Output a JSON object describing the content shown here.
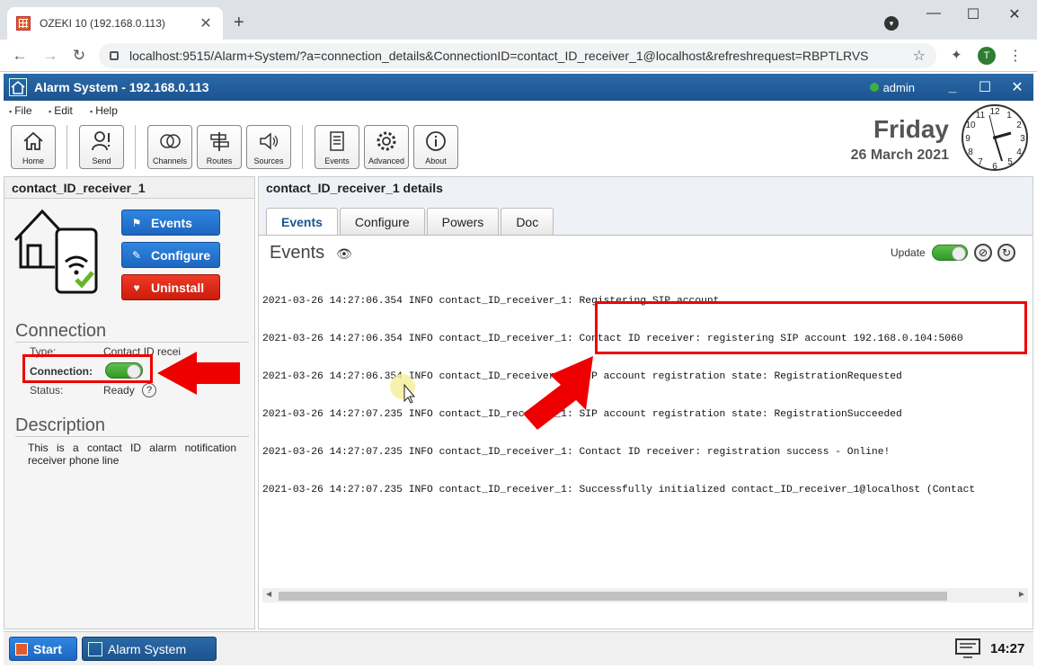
{
  "browser": {
    "tab_title": "OZEKI 10 (192.168.0.113)",
    "url": "localhost:9515/Alarm+System/?a=connection_details&ConnectionID=contact_ID_receiver_1@localhost&refreshrequest=RBPTLRVS",
    "avatar_letter": "T"
  },
  "app": {
    "title": "Alarm System - 192.168.0.113",
    "user": "admin",
    "menu": [
      "File",
      "Edit",
      "Help"
    ],
    "toolbar": [
      {
        "label": "Home",
        "icon": "home-icon"
      },
      {
        "label": "Send",
        "icon": "person-icon"
      },
      {
        "label": "Channels",
        "icon": "channels-icon"
      },
      {
        "label": "Routes",
        "icon": "routes-icon"
      },
      {
        "label": "Sources",
        "icon": "speaker-icon"
      },
      {
        "label": "Events",
        "icon": "list-icon"
      },
      {
        "label": "Advanced",
        "icon": "gear-icon"
      },
      {
        "label": "About",
        "icon": "info-icon"
      }
    ],
    "day": "Friday",
    "date": "26 March 2021"
  },
  "left": {
    "title": "contact_ID_receiver_1",
    "buttons": {
      "events": "Events",
      "configure": "Configure",
      "uninstall": "Uninstall"
    },
    "connection_heading": "Connection",
    "type_label": "Type:",
    "type_value": "Contact ID recei",
    "connection_label": "Connection:",
    "status_label": "Status:",
    "status_value": "Ready",
    "description_heading": "Description",
    "description": "This is a contact ID alarm notification receiver phone line"
  },
  "right": {
    "title": "contact_ID_receiver_1 details",
    "tabs": [
      "Events",
      "Configure",
      "Powers",
      "Doc"
    ],
    "events_heading": "Events",
    "update_label": "Update",
    "log": [
      "2021-03-26 14:27:06.354 INFO contact_ID_receiver_1: Registering SIP account",
      "2021-03-26 14:27:06.354 INFO contact_ID_receiver_1: Contact ID receiver: registering SIP account 192.168.0.104:5060",
      "2021-03-26 14:27:06.354 INFO contact_ID_receiver_1: SIP account registration state: RegistrationRequested",
      "2021-03-26 14:27:07.235 INFO contact_ID_receiver_1: SIP account registration state: RegistrationSucceeded",
      "2021-03-26 14:27:07.235 INFO contact_ID_receiver_1: Contact ID receiver: registration success - Online!",
      "2021-03-26 14:27:07.235 INFO contact_ID_receiver_1: Successfully initialized contact_ID_receiver_1@localhost (Contact"
    ]
  },
  "taskbar": {
    "start": "Start",
    "window": "Alarm System",
    "time": "14:27"
  },
  "colors": {
    "titlebar": "#1c548f",
    "button_blue": "#1d66c0",
    "button_red": "#cc1c0c",
    "toggle_on": "#3cb043",
    "highlight": "#e00000"
  }
}
